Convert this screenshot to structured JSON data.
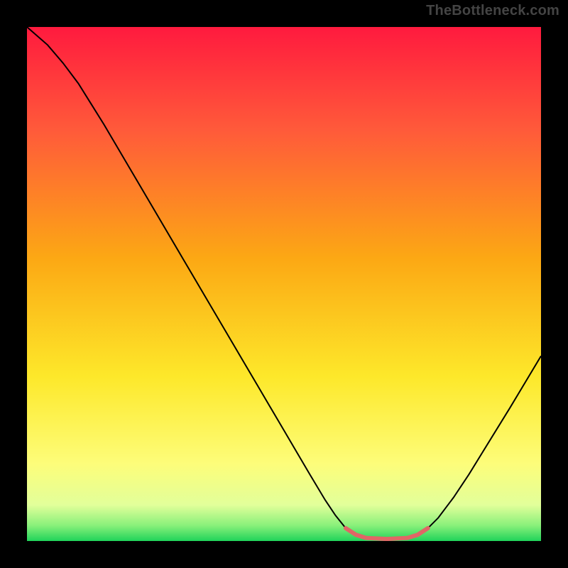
{
  "watermark": "TheBottleneck.com",
  "chart_data": {
    "type": "line",
    "title": "",
    "xlabel": "",
    "ylabel": "",
    "xlim": [
      0,
      100
    ],
    "ylim": [
      0,
      100
    ],
    "gradient_stops": [
      {
        "offset": 0.0,
        "color": "#ff1a3e"
      },
      {
        "offset": 0.2,
        "color": "#ff5a3a"
      },
      {
        "offset": 0.45,
        "color": "#fca814"
      },
      {
        "offset": 0.68,
        "color": "#fde82a"
      },
      {
        "offset": 0.85,
        "color": "#fdfd7a"
      },
      {
        "offset": 0.93,
        "color": "#e2ff9a"
      },
      {
        "offset": 0.97,
        "color": "#88f07a"
      },
      {
        "offset": 1.0,
        "color": "#20d35a"
      }
    ],
    "curve": {
      "name": "bottleneck-curve",
      "color": "#000000",
      "stroke_width": 2,
      "points": [
        {
          "x": 0.0,
          "y": 100.0
        },
        {
          "x": 4.0,
          "y": 96.5
        },
        {
          "x": 7.0,
          "y": 93.0
        },
        {
          "x": 10.0,
          "y": 89.0
        },
        {
          "x": 15.0,
          "y": 81.0
        },
        {
          "x": 20.0,
          "y": 72.5
        },
        {
          "x": 25.0,
          "y": 64.0
        },
        {
          "x": 30.0,
          "y": 55.5
        },
        {
          "x": 35.0,
          "y": 47.0
        },
        {
          "x": 40.0,
          "y": 38.5
        },
        {
          "x": 45.0,
          "y": 30.0
        },
        {
          "x": 50.0,
          "y": 21.5
        },
        {
          "x": 55.0,
          "y": 13.0
        },
        {
          "x": 58.0,
          "y": 8.0
        },
        {
          "x": 60.0,
          "y": 5.0
        },
        {
          "x": 62.0,
          "y": 2.5
        },
        {
          "x": 64.0,
          "y": 1.2
        },
        {
          "x": 66.0,
          "y": 0.6
        },
        {
          "x": 70.0,
          "y": 0.4
        },
        {
          "x": 74.0,
          "y": 0.6
        },
        {
          "x": 76.0,
          "y": 1.2
        },
        {
          "x": 78.0,
          "y": 2.5
        },
        {
          "x": 80.0,
          "y": 4.5
        },
        {
          "x": 83.0,
          "y": 8.5
        },
        {
          "x": 86.0,
          "y": 13.0
        },
        {
          "x": 90.0,
          "y": 19.5
        },
        {
          "x": 94.0,
          "y": 26.0
        },
        {
          "x": 97.0,
          "y": 31.0
        },
        {
          "x": 100.0,
          "y": 36.0
        }
      ]
    },
    "floor_segment": {
      "name": "optimal-range",
      "color": "#e06666",
      "stroke_width": 6,
      "points": [
        {
          "x": 62.0,
          "y": 2.5
        },
        {
          "x": 64.0,
          "y": 1.2
        },
        {
          "x": 66.0,
          "y": 0.6
        },
        {
          "x": 70.0,
          "y": 0.4
        },
        {
          "x": 74.0,
          "y": 0.6
        },
        {
          "x": 76.0,
          "y": 1.2
        },
        {
          "x": 78.0,
          "y": 2.5
        }
      ]
    }
  }
}
